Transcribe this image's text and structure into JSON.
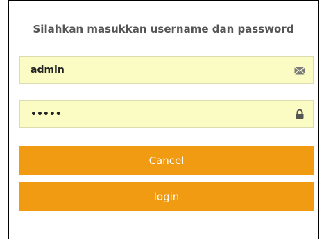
{
  "form": {
    "heading": "Silahkan masukkan username dan password",
    "username": {
      "value": "admin",
      "icon": "envelope-icon"
    },
    "password": {
      "value": "•••••",
      "icon": "lock-icon"
    },
    "cancel_label": "Cancel",
    "login_label": "login"
  },
  "colors": {
    "field_background": "#fbfcc4",
    "button_background": "#f09b12",
    "heading_text": "#555555"
  }
}
